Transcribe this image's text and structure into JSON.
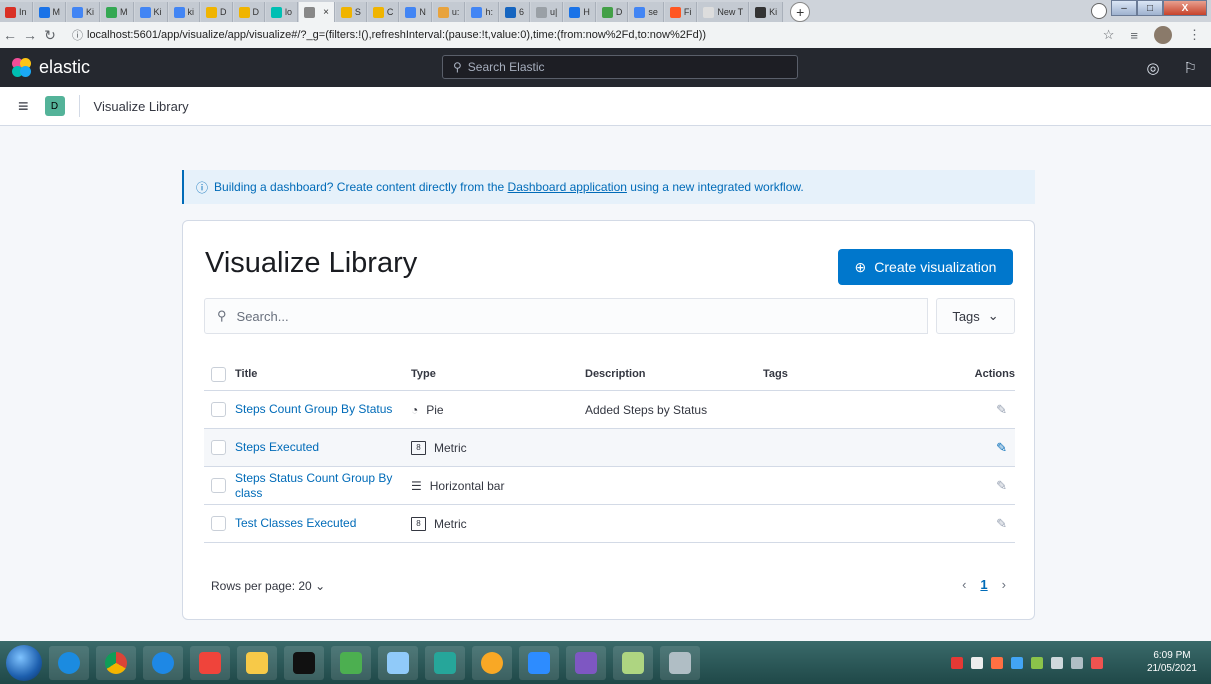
{
  "browser": {
    "tabs": [
      {
        "label": "In",
        "color": "#d93025"
      },
      {
        "label": "M",
        "color": "#1a73e8"
      },
      {
        "label": "Ki",
        "color": "#4285f4"
      },
      {
        "label": "M",
        "color": "#34a853"
      },
      {
        "label": "Ki",
        "color": "#4285f4"
      },
      {
        "label": "ki",
        "color": "#4285f4"
      },
      {
        "label": "D",
        "color": "#f0b400"
      },
      {
        "label": "D",
        "color": "#f0b400"
      },
      {
        "label": "lo",
        "color": "#00bfb3"
      },
      {
        "label": "",
        "color": "#888888",
        "active": true
      },
      {
        "label": "S",
        "color": "#f0b400"
      },
      {
        "label": "C",
        "color": "#f0b400"
      },
      {
        "label": "N",
        "color": "#4285f4"
      },
      {
        "label": "u:",
        "color": "#e8a33d"
      },
      {
        "label": "h:",
        "color": "#4285f4"
      },
      {
        "label": "6",
        "color": "#1565c0"
      },
      {
        "label": "u|",
        "color": "#9aa0a6"
      },
      {
        "label": "H",
        "color": "#1a73e8"
      },
      {
        "label": "D",
        "color": "#43a047"
      },
      {
        "label": "se",
        "color": "#4285f4"
      },
      {
        "label": "Fi",
        "color": "#ff5722"
      },
      {
        "label": "New T",
        "color": "#dddddd"
      },
      {
        "label": "Ki",
        "color": "#333333"
      }
    ],
    "url": "localhost:5601/app/visualize/app/visualize#/?_g=(filters:!(),refreshInterval:(pause:!t,value:0),time:(from:now%2Fd,to:now%2Fd))"
  },
  "header": {
    "brand": "elastic",
    "search_placeholder": "Search Elastic"
  },
  "breadcrumb": {
    "space_badge": "D",
    "current": "Visualize Library"
  },
  "callout": {
    "text_before": "Building a dashboard? Create content directly from the ",
    "link": "Dashboard application",
    "text_after": " using a new integrated workflow."
  },
  "library": {
    "title": "Visualize Library",
    "create_label": "Create visualization",
    "search_placeholder": "Search...",
    "tags_label": "Tags",
    "columns": {
      "title": "Title",
      "type": "Type",
      "description": "Description",
      "tags": "Tags",
      "actions": "Actions"
    },
    "rows": [
      {
        "title": "Steps Count Group By Status",
        "type": "Pie",
        "type_icon": "pie-icon",
        "description": "Added Steps by Status"
      },
      {
        "title": "Steps Executed",
        "type": "Metric",
        "type_icon": "metric-icon",
        "description": ""
      },
      {
        "title": "Steps Status Count Group By class",
        "type": "Horizontal bar",
        "type_icon": "horizontal-bar-icon",
        "description": ""
      },
      {
        "title": "Test Classes Executed",
        "type": "Metric",
        "type_icon": "metric-icon",
        "description": ""
      }
    ],
    "rows_per_page": "Rows per page: 20",
    "current_page": "1"
  },
  "taskbar": {
    "time": "6:09 PM",
    "date": "21/05/2021"
  }
}
